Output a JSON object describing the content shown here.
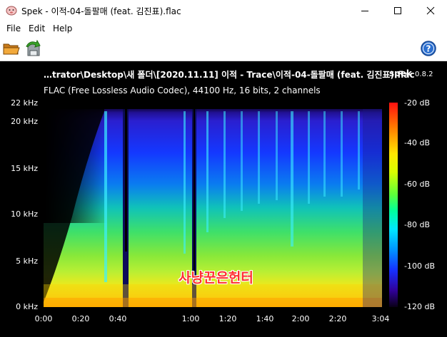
{
  "window": {
    "title": "Spek - 이적-04-돌팔매 (feat. 김진표).flac"
  },
  "menu": {
    "items": [
      "File",
      "Edit",
      "Help"
    ]
  },
  "toolbar": {
    "open_icon": "folder-open-icon",
    "save_icon": "save-icon",
    "help_icon": "help-icon"
  },
  "header": {
    "filename": "…trator\\Desktop\\새 폴더\\[2020.11.11] 이적 - Trace\\이적-04-돌팔매 (feat. 김진표).flac",
    "app_name": "spek",
    "app_version": "0.8.2",
    "codec_info": "FLAC (Free Lossless Audio Codec), 44100 Hz, 16 bits, 2 channels"
  },
  "watermark": "사냥꾼은헌터",
  "chart_data": {
    "type": "heatmap",
    "x_unit": "time (mm:ss)",
    "xlim": [
      "0:00",
      "3:04"
    ],
    "x_ticks": [
      "0:00",
      "0:20",
      "0:40",
      "1:00",
      "1:20",
      "1:40",
      "2:00",
      "2:20",
      "2:40",
      "3:04"
    ],
    "ylim_khz": [
      0,
      22
    ],
    "y_ticks": [
      "0 kHz",
      "5 kHz",
      "10 kHz",
      "15 kHz",
      "20 kHz",
      "22 kHz"
    ],
    "colorbar_db_range": [
      -120,
      -20
    ],
    "colorbar_ticks": [
      "-20 dB",
      "-40 dB",
      "-60 dB",
      "-80 dB",
      "-100 dB",
      "-120 dB"
    ],
    "colors": {
      "background": "#000000",
      "high": "#ff1010",
      "mid_high": "#ffe600",
      "mid": "#00ff9c",
      "mid_low": "#0094ff",
      "low": "#300097"
    }
  }
}
